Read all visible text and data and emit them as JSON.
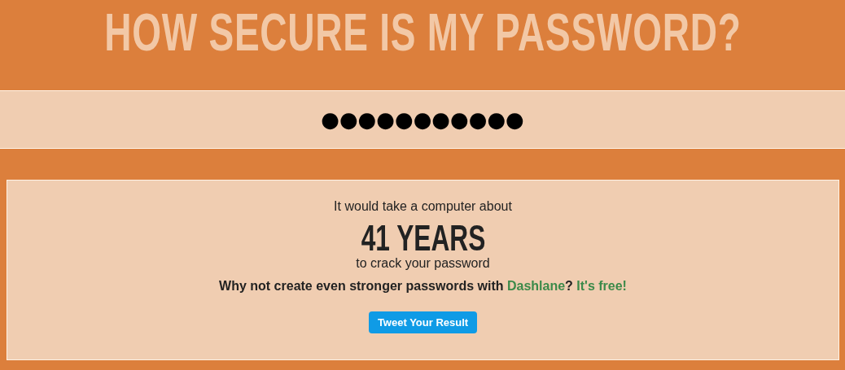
{
  "title": "HOW SECURE IS MY PASSWORD?",
  "password_field": {
    "value": "●●●●●●●●●●●"
  },
  "result": {
    "intro": "It would take a computer about",
    "time": "41 YEARS",
    "outro": "to crack your password",
    "promo": {
      "text_before": "Why not create even stronger passwords with ",
      "link": "Dashlane",
      "text_between": "? ",
      "link_2": "It's free!"
    },
    "button": "Tweet Your Result"
  }
}
